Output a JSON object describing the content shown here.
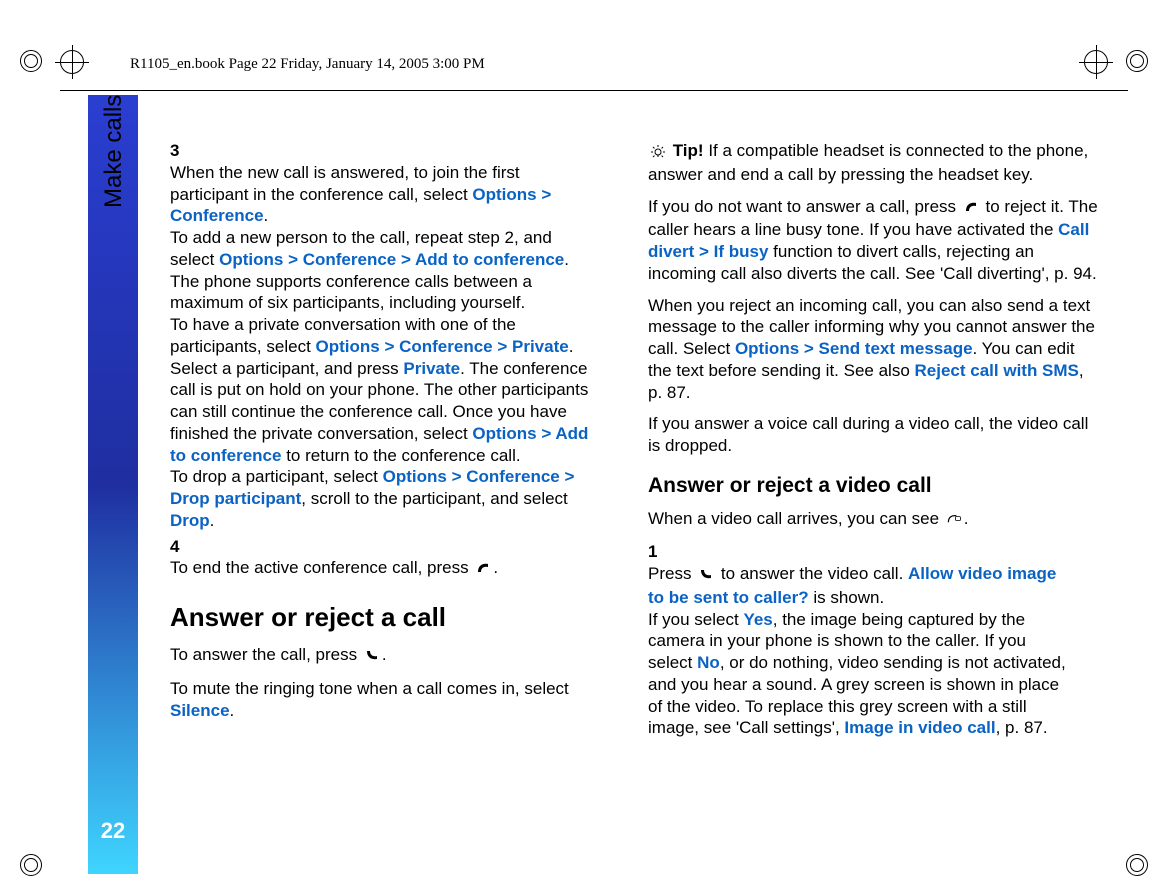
{
  "running_head": "R1105_en.book  Page 22  Friday, January 14, 2005  3:00 PM",
  "sidebar": {
    "label": "Make calls",
    "page_number": "22"
  },
  "col1": {
    "step3_lead_a": "When the new call is answered, to join the first participant in the conference call, select ",
    "opt_conf": "Options > Conference",
    "step3_add_a": "To add a new person to the call, repeat step 2, and select ",
    "opt_conf_add": "Options > Conference > Add to conference",
    "step3_add_b": ". The phone supports conference calls between a maximum of six participants, including yourself.",
    "step3_priv_a": "To have a private conversation with one of the participants, select ",
    "opt_conf_priv": "Options > Conference > Private",
    "step3_priv_b": ". Select a participant, and press ",
    "private": "Private",
    "step3_priv_c": ". The conference call is put on hold on your phone. The other participants can still continue the conference call. Once you have finished the private conversation, select ",
    "opt_add_conf": "Options > Add to conference",
    "step3_priv_d": " to return to the conference call.",
    "step3_drop_a": "To drop a participant, select ",
    "opt_conf_drop": "Options > Conference > Drop participant",
    "step3_drop_b": ", scroll to the participant, and select ",
    "drop": "Drop",
    "step4": "To end the active conference call, press ",
    "h2": "Answer or reject a call",
    "answer": "To answer the call, press ",
    "mute_a": "To mute the ringing tone when a call comes in, select ",
    "silence": "Silence"
  },
  "col2": {
    "tip_label": "Tip!",
    "tip_body": " If a compatible headset is connected to the phone, answer and end a call by pressing the headset key.",
    "reject_a": "If you do not want to answer a call, press ",
    "reject_b": " to reject it. The caller hears a line busy tone. If you have activated the ",
    "call_divert": "Call divert > If busy",
    "reject_c": " function to divert calls, rejecting an incoming call also diverts the call. See 'Call diverting', p. 94.",
    "sms_a": "When you reject an incoming call, you can also send a text message to the caller informing why you cannot answer the call. Select ",
    "opt_send_sms": "Options > Send text message",
    "sms_b": ". You can edit the text before sending it. See also ",
    "reject_sms": "Reject call with SMS",
    "sms_c": ", p. 87.",
    "vid_drop": "If you answer a voice call during a video call, the video call is dropped.",
    "h3": "Answer or reject a video call",
    "vid_arrive": "When a video call arrives, you can see ",
    "step1_a": "Press ",
    "step1_b": " to answer the video call. ",
    "allow_video": "Allow video image to be sent to caller?",
    "step1_c": " is shown.",
    "step1_d": "If you select ",
    "yes": "Yes",
    "step1_e": ", the image being captured by the camera in your phone is shown to the caller. If you select ",
    "no": "No",
    "step1_f": ", or do nothing, video sending is not activated, and you hear a sound. A grey screen is shown in place of the video. To replace this grey screen with a still image, see 'Call settings', ",
    "image_in_video": "Image in video call",
    "step1_g": ", p. 87."
  }
}
